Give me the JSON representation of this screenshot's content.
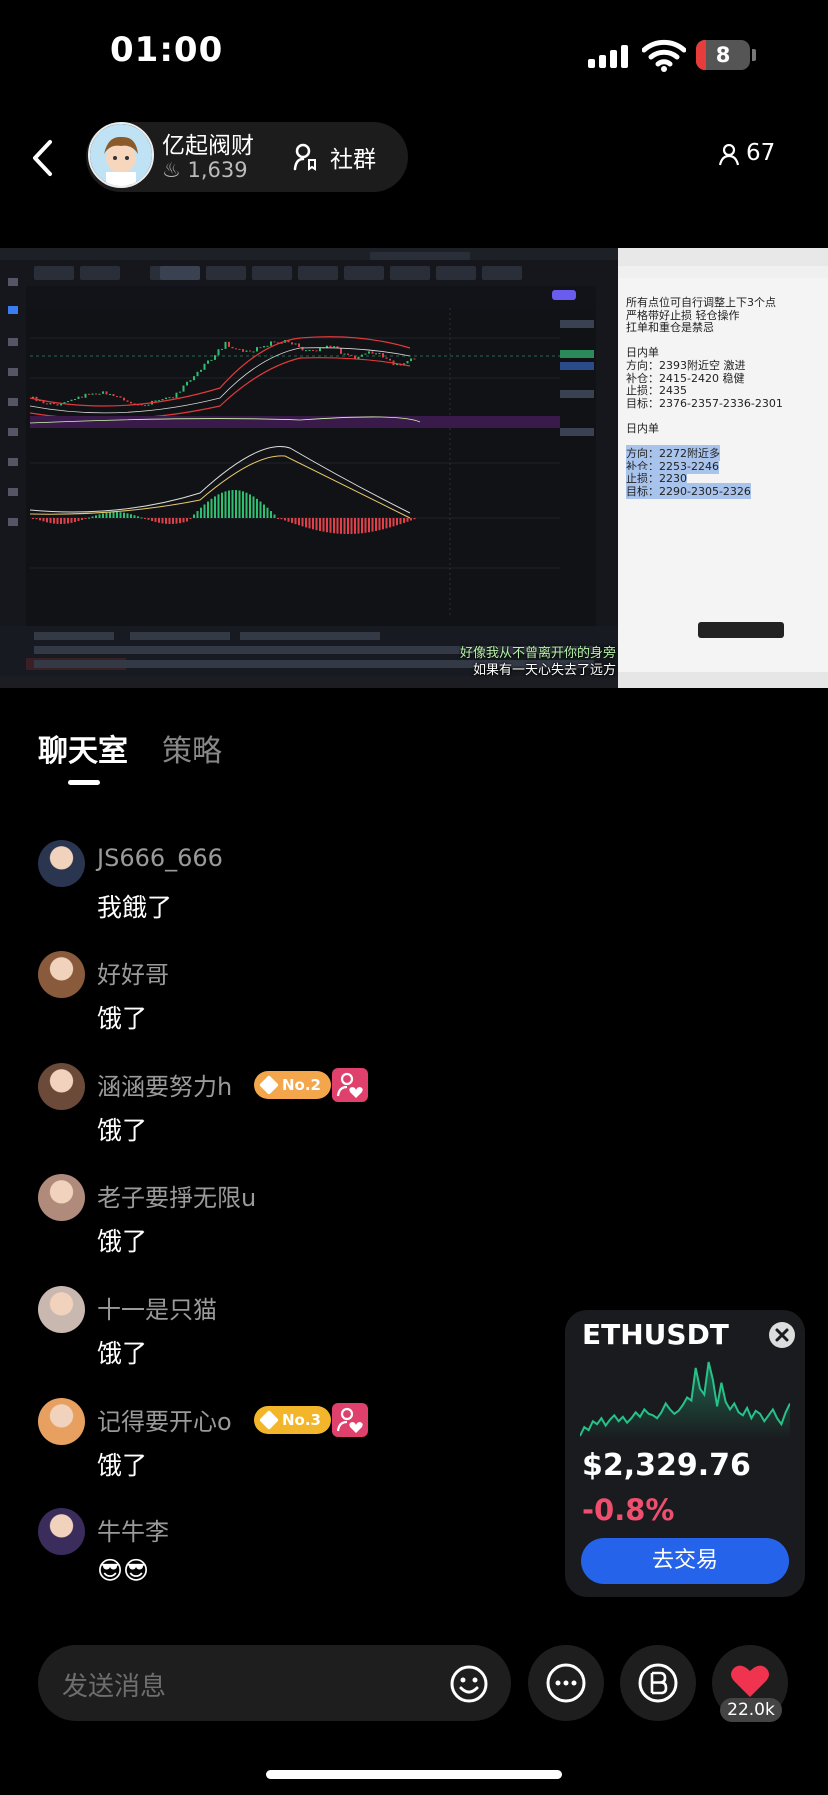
{
  "status_bar": {
    "time": "01:00",
    "battery": "8",
    "battery_level": 0.18
  },
  "header": {
    "host_name": "亿起阀财",
    "host_likes": "1,639",
    "community_label": "社群",
    "viewer_count": "67"
  },
  "stream": {
    "doc_lines": [
      {
        "text": "所有点位可自行调整上下3个点",
        "highlight": false
      },
      {
        "text": "严格带好止损    轻仓操作",
        "highlight": false
      },
      {
        "text": "扛单和重仓是禁忌",
        "highlight": false
      },
      {
        "text": "",
        "highlight": false
      },
      {
        "text": "日内单",
        "highlight": false
      },
      {
        "text": "方向：2393附近空  激进",
        "highlight": false
      },
      {
        "text": "补仓：2415-2420 稳健",
        "highlight": false
      },
      {
        "text": "止损：2435",
        "highlight": false
      },
      {
        "text": "目标：2376-2357-2336-2301",
        "highlight": false
      },
      {
        "text": "",
        "highlight": false
      },
      {
        "text": "日内单",
        "highlight": false
      },
      {
        "text": "",
        "highlight": false
      },
      {
        "text": "方向：2272附近多",
        "highlight": true
      },
      {
        "text": "补仓：2253-2246",
        "highlight": true
      },
      {
        "text": "止损：2230",
        "highlight": true
      },
      {
        "text": "目标：2290-2305-2326",
        "highlight": true
      }
    ],
    "lyrics": [
      "好像我从不曾离开你的身旁",
      "如果有一天心失去了远方"
    ]
  },
  "tabs": {
    "chat": "聊天室",
    "strategy": "策略"
  },
  "messages": [
    {
      "user": "JS666_666",
      "text": "我餓了",
      "avatar_color": "#2a3550",
      "rank_badge": "",
      "fan_badge": false
    },
    {
      "user": "好好哥",
      "text": "饿了",
      "avatar_color": "#8a5a3c",
      "rank_badge": "",
      "fan_badge": false
    },
    {
      "user": "涵涵要努力h",
      "text": "饿了",
      "avatar_color": "#6b4a3a",
      "rank_badge": "No.2",
      "fan_badge": true
    },
    {
      "user": "老子要掙无限u",
      "text": "饿了",
      "avatar_color": "#b08a7a",
      "rank_badge": "",
      "fan_badge": false
    },
    {
      "user": "十一是只猫",
      "text": "饿了",
      "avatar_color": "#c9b8b0",
      "rank_badge": "",
      "fan_badge": false
    },
    {
      "user": "记得要开心o",
      "text": "饿了",
      "avatar_color": "#e8a060",
      "rank_badge": "No.3",
      "fan_badge": true
    },
    {
      "user": "牛牛李",
      "text": "😎😎",
      "avatar_color": "#3a2d5c",
      "rank_badge": "",
      "fan_badge": false
    }
  ],
  "ticker_card": {
    "symbol": "ETHUSDT",
    "price": "$2,329.76",
    "change": "-0.8%",
    "trade_button": "去交易",
    "up_color": "#26c28a",
    "down_color": "#ef4e6e",
    "sparkline": [
      12,
      18,
      16,
      22,
      20,
      24,
      19,
      23,
      26,
      22,
      25,
      21,
      24,
      28,
      25,
      30,
      27,
      26,
      24,
      28,
      34,
      30,
      27,
      29,
      33,
      38,
      36,
      58,
      44,
      40,
      62,
      50,
      32,
      48,
      35,
      30,
      34,
      28,
      26,
      31,
      24,
      29,
      27,
      22,
      26,
      30,
      24,
      20,
      28,
      34
    ]
  },
  "composer": {
    "placeholder": "发送消息"
  },
  "like_count": "22.0k"
}
